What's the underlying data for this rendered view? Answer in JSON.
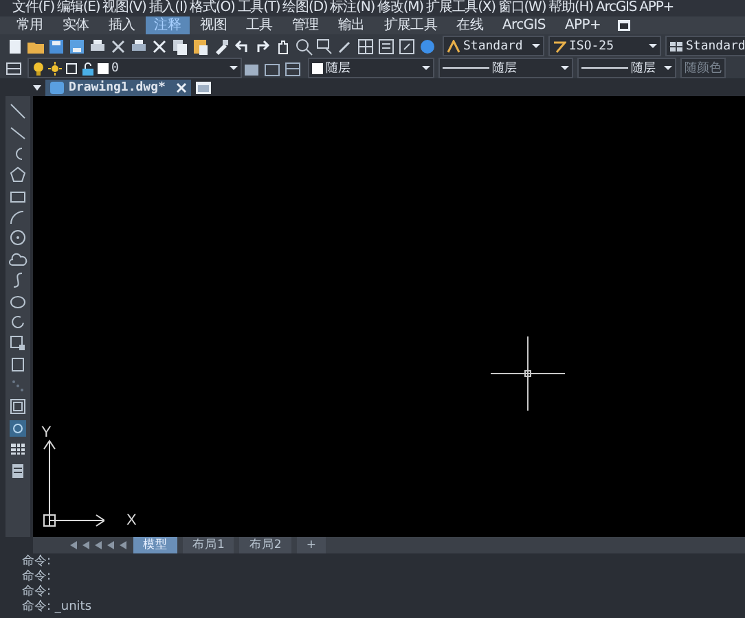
{
  "menu": [
    "文件(F)",
    "编辑(E)",
    "视图(V)",
    "插入(I)",
    "格式(O)",
    "工具(T)",
    "绘图(D)",
    "标注(N)",
    "修改(M)",
    "扩展工具(X)",
    "窗口(W)",
    "帮助(H)",
    "ArcGIS",
    "APP+"
  ],
  "ribbon_tabs": [
    {
      "label": "常用",
      "selected": false
    },
    {
      "label": "实体",
      "selected": false
    },
    {
      "label": "插入",
      "selected": false
    },
    {
      "label": "注释",
      "selected": true
    },
    {
      "label": "视图",
      "selected": false
    },
    {
      "label": "工具",
      "selected": false
    },
    {
      "label": "管理",
      "selected": false
    },
    {
      "label": "输出",
      "selected": false
    },
    {
      "label": "扩展工具",
      "selected": false
    },
    {
      "label": "在线",
      "selected": false
    },
    {
      "label": "ArcGIS",
      "selected": false
    },
    {
      "label": "APP+",
      "selected": false
    }
  ],
  "toolbar": {
    "text_style": "Standard",
    "dim_style": "ISO-25",
    "table_style": "Standard"
  },
  "layer_bar": {
    "layer": "0",
    "color_label": "随层",
    "linetype": "随层",
    "lineweight": "随层",
    "plot_style": {
      "label": "随颜色",
      "disabled": true
    }
  },
  "document_tab": {
    "title": "Drawing1.dwg*"
  },
  "canvas": {
    "y_axis_label": "Y",
    "x_axis_label": "X"
  },
  "layout_tabs": [
    {
      "label": "模型",
      "selected": true
    },
    {
      "label": "布局1",
      "selected": false
    },
    {
      "label": "布局2",
      "selected": false
    },
    {
      "label": "+",
      "selected": false
    }
  ],
  "command_lines": [
    "命令:",
    "命令:",
    "命令:",
    "命令: _units"
  ]
}
